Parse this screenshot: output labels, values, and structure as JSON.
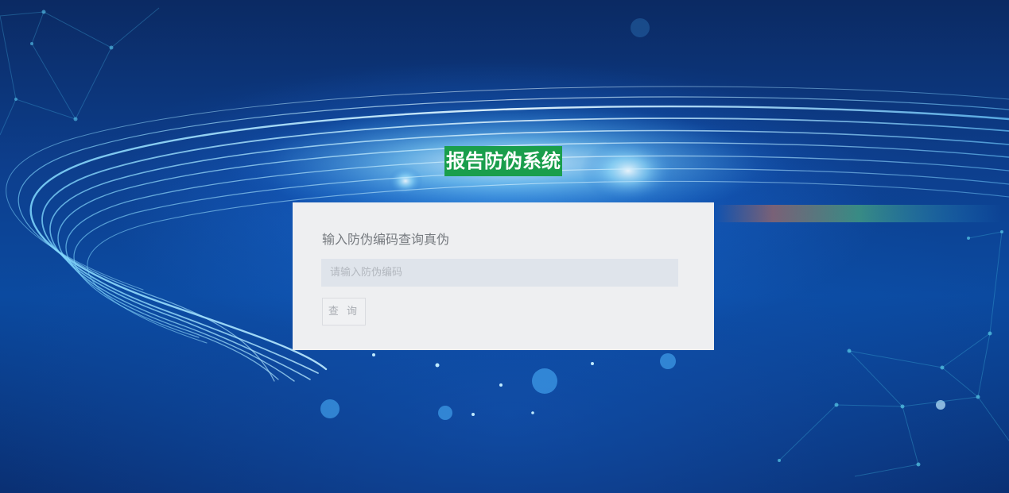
{
  "page": {
    "title": "报告防伪系统"
  },
  "panel": {
    "heading": "输入防伪编码查询真伪",
    "input_placeholder": "请输入防伪编码",
    "input_value": "",
    "query_button_label": "查 询"
  },
  "colors": {
    "title_bg": "#1a9e4c",
    "panel_bg": "#eeeff1",
    "input_bg": "#dfe4eb"
  }
}
